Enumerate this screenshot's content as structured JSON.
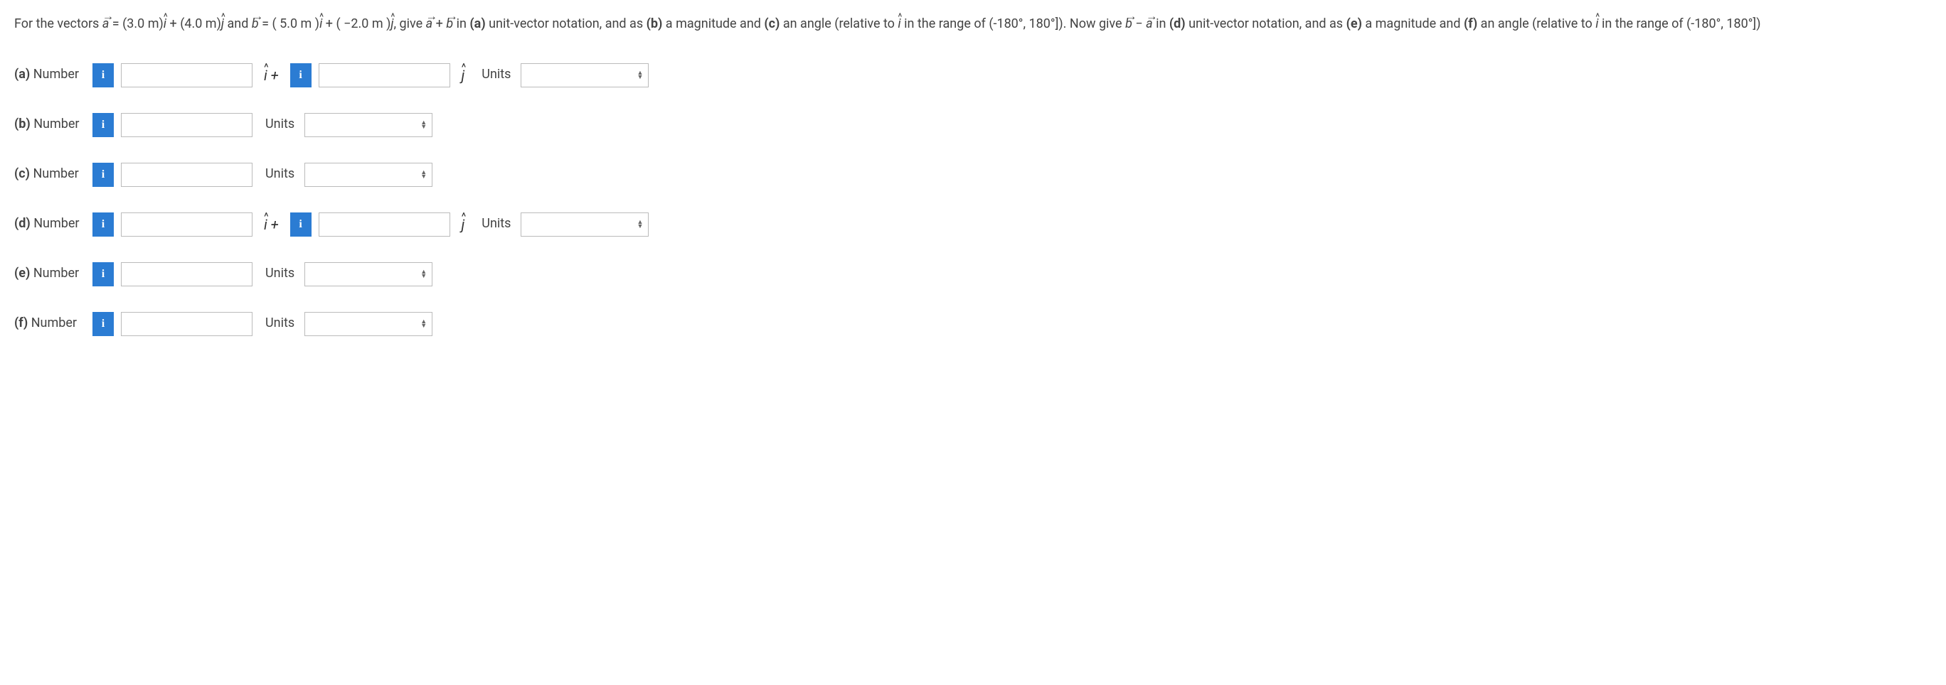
{
  "question": {
    "text_a": "For the vectors ",
    "vec_a": "a",
    "eq_a": " = (3.0 m)",
    "ihat1": "i",
    "plus_a": " + (4.0 m)",
    "jhat1": "j",
    "and_text": " and ",
    "vec_b": "b",
    "eq_b": " = ( 5.0 m )",
    "ihat2": "i",
    "plus_b": " + ( −2.0 m )",
    "jhat2": "j",
    "give_text": ", give ",
    "plus_text": " + ",
    "in_a": " in ",
    "part_a_b": "(a)",
    "unv": " unit-vector notation, and as ",
    "part_b_b": "(b)",
    "mag": " a magnitude and ",
    "part_c_b": "(c)",
    "angle": " an angle (relative to ",
    "ihat3": "i",
    "range1": " in the range of (-180°, 180°]). Now give ",
    "minus_text": " − ",
    "in_d": " in ",
    "part_d_b": "(d)",
    "unv2": " unit-vector notation, and as ",
    "part_e_b": "(e)",
    "mag2": " a magnitude and ",
    "part_f_b": "(f)",
    "angle2": " an angle (relative to ",
    "ihat4": "i",
    "range2": " in the range of (-180°, 180°])"
  },
  "labels": {
    "number": "Number",
    "units": "Units",
    "info": "i",
    "ihat_plus": "î + ",
    "jhat": "ĵ"
  },
  "parts": {
    "a": "(a)",
    "b": "(b)",
    "c": "(c)",
    "d": "(d)",
    "e": "(e)",
    "f": "(f)"
  }
}
